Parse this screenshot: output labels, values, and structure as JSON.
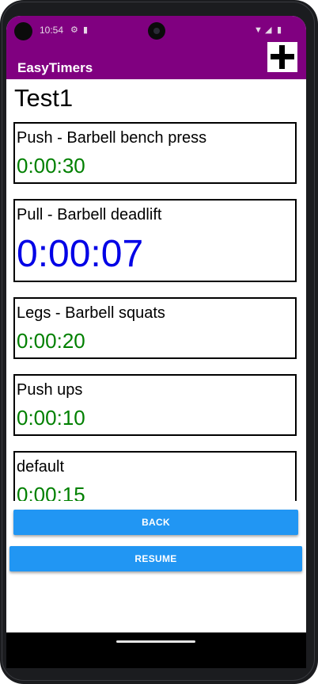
{
  "status_bar": {
    "time": "10:54",
    "icons": [
      "settings-icon",
      "sim-card-icon",
      "wifi-icon",
      "signal-icon",
      "battery-icon"
    ]
  },
  "toolbar": {
    "title": "EasyTimers",
    "add_icon": "plus-icon"
  },
  "page": {
    "title": "Test1"
  },
  "timers": [
    {
      "name": "Push - Barbell bench press",
      "time": "0:00:30",
      "active": false
    },
    {
      "name": "Pull - Barbell deadlift",
      "time": "0:00:07",
      "active": true
    },
    {
      "name": "Legs - Barbell squats",
      "time": "0:00:20",
      "active": false
    },
    {
      "name": "Push ups",
      "time": "0:00:10",
      "active": false
    },
    {
      "name": "default",
      "time": "0:00:15",
      "active": false
    }
  ],
  "buttons": {
    "back_label": "BACK",
    "resume_label": "RESUME"
  },
  "colors": {
    "app_bar": "#800080",
    "timer_idle": "#008000",
    "timer_active": "#0000e6",
    "button": "#2196f3"
  }
}
